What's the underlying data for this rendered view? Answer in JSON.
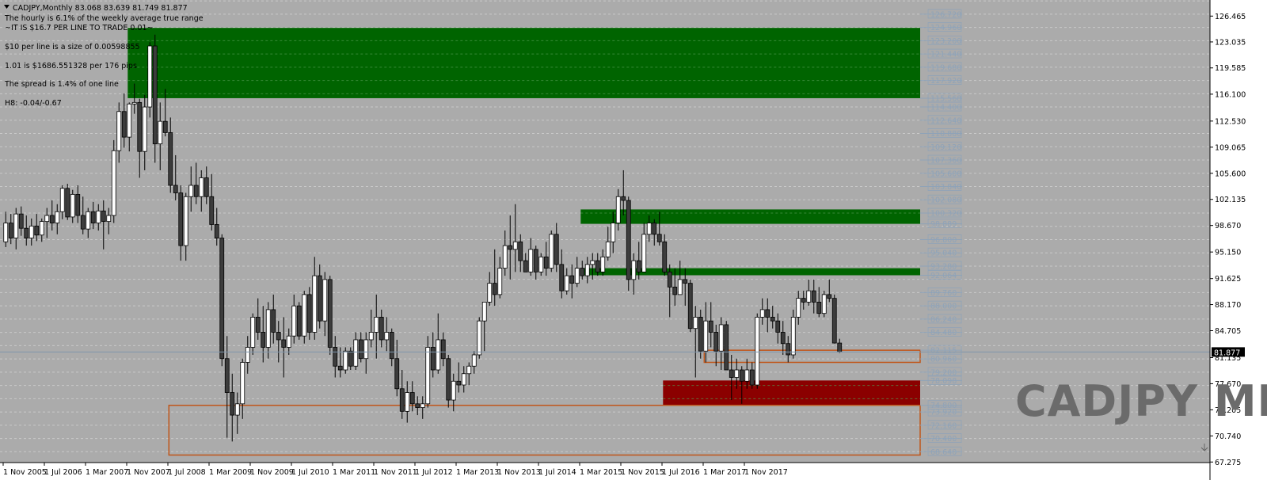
{
  "header": {
    "symbol_line": "CADJPY,Monthly  83.068 83.639 81.749 81.877",
    "notes": [
      "The hourly is 6.1% of the weekly average true range",
      "~IT IS $16.7 PER LINE TO TRADE 0.01~",
      "$10 per line is a size of 0.00598855",
      "1.01 is $1686.551328 per 176 pips",
      "The spread is 1.4% of one line",
      "H8: -0.04/-0.67"
    ]
  },
  "watermark": "CADJPY MN",
  "colors": {
    "background": "#ababab",
    "supply_zone": "#006400",
    "demand_zone": "#8b0000",
    "box_outline": "#c0561a",
    "grid_line": "#c9c9c9",
    "level_line": "#8fa3b8",
    "candle_bull": "#ffffff",
    "candle_bear": "#3c3c3c",
    "wick": "#000000"
  },
  "chart_data": {
    "type": "candlestick",
    "symbol": "CADJPY",
    "timeframe": "Monthly",
    "last_price": 81.877,
    "ohlc_last": {
      "open": 83.068,
      "high": 83.639,
      "low": 81.749,
      "close": 81.877
    },
    "ylim": [
      67.2,
      128.6
    ],
    "y_axis_ticks": [
      126.465,
      123.035,
      119.585,
      116.1,
      112.53,
      109.065,
      105.6,
      102.135,
      98.67,
      95.15,
      91.625,
      88.17,
      84.705,
      81.135,
      77.67,
      74.205,
      70.74,
      67.275
    ],
    "x_axis_labels": [
      "1 Nov 2005",
      "1 Jul 2006",
      "1 Mar 2007",
      "1 Nov 2007",
      "1 Jul 2008",
      "1 Mar 2009",
      "1 Nov 2009",
      "1 Jul 2010",
      "1 Mar 2011",
      "1 Nov 2011",
      "1 Jul 2012",
      "1 Mar 2013",
      "1 Nov 2013",
      "1 Jul 2014",
      "1 Mar 2015",
      "1 Nov 2015",
      "1 Jul 2016",
      "1 Mar 2017",
      "1 Nov 2017"
    ],
    "grid_levels": [
      128.48,
      126.72,
      124.96,
      123.2,
      121.44,
      119.68,
      117.92,
      116.16,
      114.4,
      112.64,
      110.88,
      109.12,
      107.36,
      105.6,
      103.84,
      102.08,
      100.32,
      98.56,
      96.8,
      95.04,
      93.28,
      91.52,
      89.76,
      88.0,
      86.24,
      84.48,
      82.72,
      80.96,
      79.2,
      77.44,
      75.68,
      73.92,
      72.16,
      70.4,
      68.64,
      66.88
    ],
    "level_labels": [
      126.72,
      124.96,
      123.2,
      121.44,
      119.68,
      117.92,
      115.568,
      114.4,
      112.64,
      110.88,
      109.12,
      107.36,
      105.6,
      103.84,
      102.08,
      100.32,
      98.889,
      96.8,
      95.04,
      93.28,
      92.064,
      89.76,
      88.0,
      86.24,
      84.48,
      82.115,
      80.96,
      79.2,
      78.098,
      74.8,
      73.92,
      72.16,
      70.4,
      68.64
    ],
    "zones": [
      {
        "kind": "supply",
        "top": 124.9,
        "bottom": 115.568,
        "x_start_label": "1 Nov 2007",
        "label": 115.568
      },
      {
        "kind": "supply",
        "top": 100.8,
        "bottom": 98.889,
        "x_start_label": "1 Mar 2015",
        "label": 98.889
      },
      {
        "kind": "supply",
        "top": 93.0,
        "bottom": 92.064,
        "x_start_label": "1 Mar 2015",
        "label": 92.064
      },
      {
        "kind": "demand",
        "top": 78.098,
        "bottom": 74.8,
        "x_start_label": "1 Jul 2016",
        "label": 78.098,
        "label2": 74.8
      },
      {
        "kind": "box",
        "top": 74.8,
        "bottom": 68.2,
        "x_start_label": "1 Jul 2008"
      },
      {
        "kind": "box",
        "top": 82.115,
        "bottom": 80.5,
        "x_start_label": "1 Mar 2017",
        "label": 82.115
      }
    ],
    "candles": [
      [
        96.5,
        100.5,
        95.8,
        99.0
      ],
      [
        99.0,
        100.2,
        96.2,
        97.0
      ],
      [
        97.0,
        101.0,
        95.5,
        100.2
      ],
      [
        100.2,
        101.2,
        97.3,
        98.3
      ],
      [
        98.3,
        100.0,
        96.0,
        97.0
      ],
      [
        97.0,
        99.6,
        96.0,
        98.6
      ],
      [
        98.6,
        100.2,
        96.6,
        97.4
      ],
      [
        97.4,
        99.6,
        96.5,
        99.2
      ],
      [
        99.2,
        101.0,
        97.0,
        100.0
      ],
      [
        100.0,
        102.0,
        98.0,
        99.0
      ],
      [
        99.0,
        101.5,
        97.5,
        100.5
      ],
      [
        100.5,
        104.0,
        99.5,
        103.6
      ],
      [
        103.6,
        104.2,
        99.4,
        99.8
      ],
      [
        99.8,
        103.4,
        99.0,
        102.8
      ],
      [
        102.8,
        104.0,
        99.0,
        100.0
      ],
      [
        100.0,
        102.5,
        97.5,
        98.2
      ],
      [
        98.2,
        101.0,
        97.0,
        100.5
      ],
      [
        100.5,
        101.8,
        98.2,
        99.0
      ],
      [
        99.0,
        101.5,
        98.0,
        100.6
      ],
      [
        100.6,
        102.0,
        95.5,
        99.2
      ],
      [
        99.2,
        101.0,
        97.5,
        100.0
      ],
      [
        100.0,
        110.0,
        99.0,
        108.6
      ],
      [
        108.6,
        115.0,
        107.0,
        113.8
      ],
      [
        113.8,
        116.2,
        109.0,
        110.4
      ],
      [
        110.4,
        115.0,
        108.5,
        114.8
      ],
      [
        114.8,
        117.5,
        113.5,
        115.0
      ],
      [
        115.0,
        115.5,
        105.0,
        108.5
      ],
      [
        108.5,
        116.0,
        106.0,
        114.4
      ],
      [
        114.4,
        123.0,
        113.0,
        122.5
      ],
      [
        122.5,
        124.0,
        107.0,
        109.5
      ],
      [
        109.5,
        115.0,
        106.0,
        112.5
      ],
      [
        112.5,
        116.8,
        110.5,
        111.0
      ],
      [
        111.0,
        113.0,
        103.0,
        104.0
      ],
      [
        104.0,
        108.0,
        102.0,
        103.0
      ],
      [
        103.0,
        104.0,
        94.0,
        96.0
      ],
      [
        96.0,
        103.0,
        94.0,
        102.5
      ],
      [
        102.5,
        106.5,
        100.5,
        104.0
      ],
      [
        104.0,
        107.0,
        101.5,
        102.5
      ],
      [
        102.5,
        106.0,
        100.5,
        105.0
      ],
      [
        105.0,
        106.5,
        101.5,
        102.5
      ],
      [
        102.5,
        105.5,
        98.0,
        98.8
      ],
      [
        98.8,
        101.0,
        96.0,
        97.0
      ],
      [
        97.0,
        97.5,
        80.0,
        81.0
      ],
      [
        81.0,
        84.0,
        70.5,
        76.5
      ],
      [
        76.5,
        79.0,
        70.0,
        73.5
      ],
      [
        73.5,
        76.5,
        71.0,
        75.0
      ],
      [
        75.0,
        81.0,
        73.0,
        80.5
      ],
      [
        80.5,
        84.0,
        79.0,
        82.5
      ],
      [
        82.5,
        87.0,
        81.5,
        86.5
      ],
      [
        86.5,
        89.0,
        83.5,
        84.5
      ],
      [
        84.5,
        88.0,
        80.5,
        82.5
      ],
      [
        82.5,
        88.5,
        81.0,
        87.5
      ],
      [
        87.5,
        89.5,
        83.0,
        84.5
      ],
      [
        84.5,
        86.0,
        80.5,
        83.5
      ],
      [
        83.5,
        86.5,
        78.5,
        82.5
      ],
      [
        82.5,
        85.0,
        81.5,
        84.0
      ],
      [
        84.0,
        89.5,
        83.0,
        88.0
      ],
      [
        88.0,
        88.5,
        83.5,
        84.0
      ],
      [
        84.0,
        90.0,
        83.0,
        89.5
      ],
      [
        89.5,
        90.5,
        83.5,
        84.5
      ],
      [
        84.5,
        94.5,
        83.5,
        92.0
      ],
      [
        92.0,
        93.5,
        85.0,
        86.0
      ],
      [
        86.0,
        92.5,
        84.0,
        91.5
      ],
      [
        91.5,
        92.0,
        81.5,
        82.5
      ],
      [
        82.5,
        84.0,
        78.5,
        80.0
      ],
      [
        80.0,
        82.5,
        78.5,
        79.5
      ],
      [
        79.5,
        82.5,
        79.0,
        82.0
      ],
      [
        82.0,
        82.5,
        79.5,
        80.0
      ],
      [
        80.0,
        84.5,
        79.5,
        83.5
      ],
      [
        83.5,
        84.5,
        80.5,
        81.0
      ],
      [
        81.0,
        84.5,
        79.0,
        83.5
      ],
      [
        83.5,
        87.5,
        82.5,
        84.5
      ],
      [
        84.5,
        89.5,
        81.0,
        86.5
      ],
      [
        86.5,
        87.5,
        82.5,
        83.5
      ],
      [
        83.5,
        86.5,
        82.0,
        84.5
      ],
      [
        84.5,
        85.0,
        80.0,
        81.0
      ],
      [
        81.0,
        83.5,
        76.0,
        77.0
      ],
      [
        77.0,
        79.5,
        73.0,
        74.0
      ],
      [
        74.0,
        78.0,
        72.5,
        76.5
      ],
      [
        76.5,
        78.0,
        74.0,
        75.0
      ],
      [
        75.0,
        76.0,
        73.5,
        74.5
      ],
      [
        74.5,
        76.0,
        73.0,
        75.0
      ],
      [
        75.0,
        84.0,
        74.5,
        82.5
      ],
      [
        82.5,
        84.5,
        78.5,
        79.5
      ],
      [
        79.5,
        87.0,
        79.0,
        83.5
      ],
      [
        83.5,
        84.5,
        80.0,
        81.0
      ],
      [
        81.0,
        81.5,
        74.5,
        75.5
      ],
      [
        75.5,
        79.0,
        74.0,
        78.0
      ],
      [
        78.0,
        80.5,
        76.5,
        77.5
      ],
      [
        77.5,
        80.0,
        76.5,
        79.0
      ],
      [
        79.0,
        80.5,
        77.5,
        80.0
      ],
      [
        80.0,
        82.0,
        79.0,
        81.5
      ],
      [
        81.5,
        86.5,
        81.0,
        86.0
      ],
      [
        86.0,
        87.5,
        82.0,
        88.5
      ],
      [
        88.5,
        92.5,
        88.0,
        91.0
      ],
      [
        91.0,
        95.5,
        88.0,
        89.5
      ],
      [
        89.5,
        94.5,
        89.0,
        93.0
      ],
      [
        93.0,
        98.0,
        92.0,
        96.0
      ],
      [
        96.0,
        100.0,
        91.5,
        95.5
      ],
      [
        95.5,
        101.5,
        92.5,
        96.5
      ],
      [
        96.5,
        97.5,
        92.5,
        94.0
      ],
      [
        94.0,
        95.0,
        92.5,
        92.5
      ],
      [
        92.5,
        97.0,
        92.0,
        95.5
      ],
      [
        95.5,
        96.0,
        91.5,
        92.5
      ],
      [
        92.5,
        95.0,
        92.0,
        94.5
      ],
      [
        94.5,
        96.5,
        92.0,
        93.0
      ],
      [
        93.0,
        98.0,
        92.5,
        97.5
      ],
      [
        97.5,
        99.0,
        92.5,
        93.5
      ],
      [
        93.5,
        95.5,
        89.0,
        90.0
      ],
      [
        90.0,
        93.0,
        89.5,
        92.0
      ],
      [
        92.0,
        93.5,
        89.0,
        91.0
      ],
      [
        91.0,
        94.5,
        90.5,
        93.0
      ],
      [
        93.0,
        94.0,
        91.5,
        92.0
      ],
      [
        92.0,
        94.5,
        91.0,
        93.5
      ],
      [
        93.5,
        95.0,
        91.5,
        94.0
      ],
      [
        94.0,
        95.0,
        92.0,
        92.5
      ],
      [
        92.5,
        95.5,
        92.0,
        94.5
      ],
      [
        94.5,
        98.5,
        94.0,
        96.5
      ],
      [
        96.5,
        100.5,
        95.0,
        99.0
      ],
      [
        99.0,
        103.5,
        98.0,
        102.5
      ],
      [
        102.5,
        106.0,
        100.0,
        102.0
      ],
      [
        102.0,
        102.5,
        90.0,
        91.5
      ],
      [
        91.5,
        95.0,
        89.5,
        94.0
      ],
      [
        94.0,
        96.5,
        91.5,
        92.5
      ],
      [
        92.5,
        99.0,
        92.5,
        97.5
      ],
      [
        97.5,
        100.0,
        96.5,
        99.0
      ],
      [
        99.0,
        99.5,
        96.0,
        97.5
      ],
      [
        97.5,
        100.5,
        96.0,
        96.5
      ],
      [
        96.5,
        97.5,
        92.0,
        92.5
      ],
      [
        92.5,
        93.5,
        86.5,
        90.5
      ],
      [
        90.5,
        93.0,
        88.0,
        89.5
      ],
      [
        89.5,
        94.0,
        89.5,
        91.5
      ],
      [
        91.5,
        93.0,
        88.0,
        91.0
      ],
      [
        91.0,
        91.5,
        84.5,
        85.0
      ],
      [
        85.0,
        88.0,
        78.5,
        86.5
      ],
      [
        86.5,
        87.5,
        81.0,
        82.0
      ],
      [
        82.0,
        88.5,
        80.5,
        86.0
      ],
      [
        86.0,
        88.5,
        82.5,
        84.5
      ],
      [
        84.5,
        85.5,
        80.0,
        82.0
      ],
      [
        82.0,
        86.5,
        79.5,
        85.5
      ],
      [
        85.5,
        86.0,
        79.5,
        79.5
      ],
      [
        79.5,
        81.5,
        75.5,
        78.5
      ],
      [
        78.5,
        81.0,
        77.0,
        79.5
      ],
      [
        79.5,
        80.0,
        75.0,
        78.0
      ],
      [
        78.0,
        81.0,
        77.0,
        79.5
      ],
      [
        79.5,
        80.5,
        77.0,
        77.5
      ],
      [
        77.5,
        87.0,
        77.0,
        86.5
      ],
      [
        86.5,
        89.0,
        85.5,
        87.5
      ],
      [
        87.5,
        89.0,
        84.5,
        86.5
      ],
      [
        86.5,
        88.0,
        85.0,
        86.0
      ],
      [
        86.0,
        87.0,
        83.0,
        84.5
      ],
      [
        84.5,
        86.0,
        81.5,
        83.0
      ],
      [
        83.0,
        84.0,
        80.5,
        81.5
      ],
      [
        81.5,
        87.5,
        81.0,
        86.5
      ],
      [
        86.5,
        90.0,
        85.5,
        89.0
      ],
      [
        89.0,
        90.0,
        87.5,
        88.5
      ],
      [
        88.5,
        91.5,
        88.0,
        90.0
      ],
      [
        90.0,
        91.5,
        87.0,
        88.5
      ],
      [
        88.5,
        90.5,
        86.5,
        87.0
      ],
      [
        87.0,
        90.0,
        86.5,
        89.5
      ],
      [
        89.5,
        91.5,
        88.5,
        89.0
      ],
      [
        89.0,
        89.5,
        83.0,
        83.068
      ],
      [
        83.068,
        83.639,
        81.749,
        81.877
      ]
    ]
  }
}
